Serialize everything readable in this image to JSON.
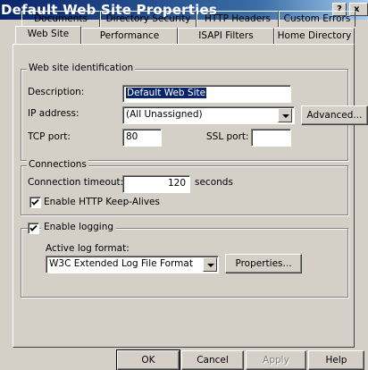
{
  "window": {
    "title": "Default Web Site Properties",
    "help_glyph": "?",
    "close_glyph": "x"
  },
  "tabs": {
    "back_row": [
      "Documents",
      "Directory Security",
      "HTTP Headers",
      "Custom Errors"
    ],
    "front_row": [
      "Web Site",
      "Performance",
      "ISAPI Filters",
      "Home Directory"
    ],
    "active": "Web Site"
  },
  "identification": {
    "legend": "Web site identification",
    "description_label": "Description:",
    "description_value": "Default Web Site",
    "ip_label": "IP address:",
    "ip_value": "(All Unassigned)",
    "advanced_button": "Advanced...",
    "tcp_label": "TCP port:",
    "tcp_value": "80",
    "ssl_label": "SSL port:",
    "ssl_value": ""
  },
  "connections": {
    "legend": "Connections",
    "timeout_label": "Connection timeout:",
    "timeout_value": "120",
    "timeout_unit": "seconds",
    "keepalive_label": "Enable HTTP Keep-Alives",
    "keepalive_checked": true
  },
  "logging": {
    "enable_label": "Enable logging",
    "enable_checked": true,
    "format_label": "Active log format:",
    "format_value": "W3C Extended Log File Format",
    "properties_button": "Properties..."
  },
  "buttons": {
    "ok": "OK",
    "cancel": "Cancel",
    "apply": "Apply",
    "help": "Help"
  },
  "icons": {
    "dropdown": "chevron-down-icon",
    "check": "checkmark-icon"
  }
}
